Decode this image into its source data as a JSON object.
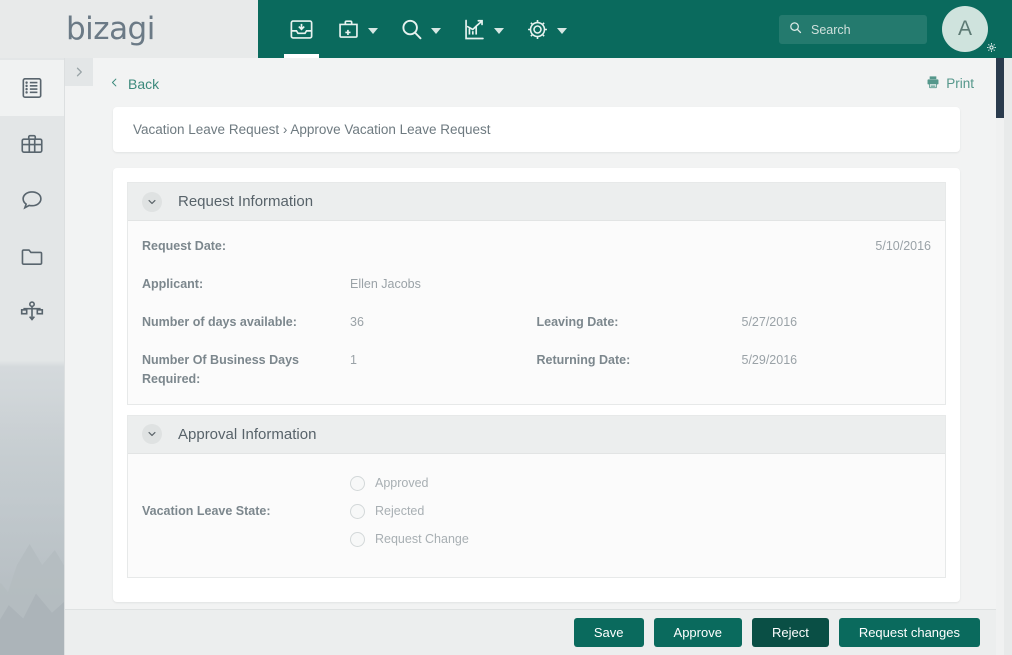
{
  "brand": {
    "logo_text": "bizagi",
    "accent_color": "#0a6a5d",
    "dark_accent": "#0a4f45"
  },
  "sidebar": {
    "expand_toggle": "chevron-right-icon",
    "items": [
      {
        "name": "news-icon",
        "label": "News"
      },
      {
        "name": "list-icon",
        "label": "Inbox List"
      },
      {
        "name": "briefcase-icon",
        "label": "Cases"
      },
      {
        "name": "chat-icon",
        "label": "Messages"
      },
      {
        "name": "folder-icon",
        "label": "Documents"
      },
      {
        "name": "workflow-icon",
        "label": "Processes"
      }
    ]
  },
  "topbar": {
    "icons": [
      {
        "name": "inbox-icon",
        "label": "Inbox",
        "active": true,
        "caret": false
      },
      {
        "name": "new-case-icon",
        "label": "New Case",
        "active": false,
        "caret": true
      },
      {
        "name": "search-nav-icon",
        "label": "Search",
        "active": false,
        "caret": true
      },
      {
        "name": "analytics-icon",
        "label": "Analytics",
        "active": false,
        "caret": true
      },
      {
        "name": "settings-icon",
        "label": "Admin",
        "active": false,
        "caret": true
      }
    ],
    "search": {
      "placeholder": "Search",
      "value": ""
    },
    "avatar": {
      "initial": "A",
      "badge": "gear-icon"
    }
  },
  "toolbar": {
    "back_label": "Back",
    "print_label": "Print"
  },
  "breadcrumb": {
    "text": "Vacation Leave Request › Approve Vacation Leave Request"
  },
  "sections": {
    "request_information": {
      "title": "Request Information",
      "fields": {
        "request_date_label": "Request Date:",
        "request_date_value": "5/10/2016",
        "applicant_label": "Applicant:",
        "applicant_value": "Ellen Jacobs",
        "days_available_label": "Number of days available:",
        "days_available_value": "36",
        "leaving_date_label": "Leaving Date:",
        "leaving_date_value": "5/27/2016",
        "business_days_label": "Number Of Business Days Required:",
        "business_days_value": "1",
        "returning_date_label": "Returning Date:",
        "returning_date_value": "5/29/2016"
      }
    },
    "approval_information": {
      "title": "Approval Information",
      "state_label": "Vacation Leave State:",
      "options": [
        {
          "label": "Approved",
          "selected": false
        },
        {
          "label": "Rejected",
          "selected": false
        },
        {
          "label": "Request Change",
          "selected": false
        }
      ]
    }
  },
  "footer": {
    "buttons": [
      {
        "label": "Save",
        "style": "normal"
      },
      {
        "label": "Approve",
        "style": "normal"
      },
      {
        "label": "Reject",
        "style": "dark"
      },
      {
        "label": "Request changes",
        "style": "normal"
      }
    ]
  }
}
